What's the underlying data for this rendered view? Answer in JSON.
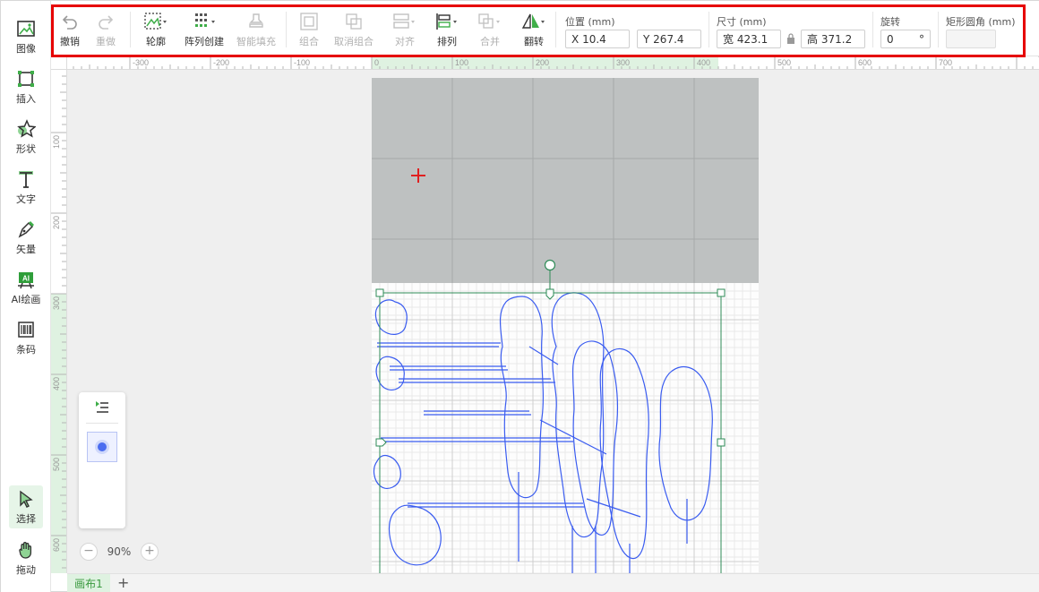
{
  "sidebar": {
    "items": [
      {
        "key": "image",
        "label": "图像",
        "icon": "image-icon"
      },
      {
        "key": "insert",
        "label": "插入",
        "icon": "insert-frame-icon"
      },
      {
        "key": "shape",
        "label": "形状",
        "icon": "star-shape-icon"
      },
      {
        "key": "text",
        "label": "文字",
        "icon": "text-icon"
      },
      {
        "key": "vector",
        "label": "矢量",
        "icon": "pen-icon"
      },
      {
        "key": "ai-draw",
        "label": "AI绘画",
        "icon": "ai-icon"
      },
      {
        "key": "barcode",
        "label": "条码",
        "icon": "barcode-icon"
      },
      {
        "key": "select",
        "label": "选择",
        "icon": "cursor-icon",
        "active": true
      },
      {
        "key": "drag",
        "label": "拖动",
        "icon": "hand-icon"
      }
    ],
    "ai_badge": "AI"
  },
  "toolbar": {
    "undo": "撤销",
    "redo": "重做",
    "outline": "轮廓",
    "array_create": "阵列创建",
    "smart_fill": "智能填充",
    "group": "组合",
    "ungroup": "取消组合",
    "align": "对齐",
    "arrange": "排列",
    "merge": "合并",
    "flip": "翻转",
    "position": {
      "title": "位置 (mm)",
      "x_label": "X",
      "x_value": "10.4",
      "y_label": "Y",
      "y_value": "267.4"
    },
    "size": {
      "title": "尺寸 (mm)",
      "w_label": "宽",
      "w_value": "423.1",
      "h_label": "高",
      "h_value": "371.2"
    },
    "rotation": {
      "title": "旋转",
      "value": "0",
      "unit": "°"
    },
    "corner": {
      "title": "矩形圆角 (mm)",
      "value": ""
    }
  },
  "ruler": {
    "top_ticks": [
      "-300",
      "-200",
      "-100",
      "0",
      "100",
      "200",
      "300",
      "400",
      "500",
      "600",
      "700"
    ],
    "left_ticks": [
      "100",
      "200",
      "300",
      "400",
      "500",
      "600"
    ]
  },
  "zoom": {
    "value": "90%",
    "minus": "−",
    "plus": "+"
  },
  "pages": {
    "tab_label": "画布1",
    "add_label": "+"
  },
  "colors": {
    "accent": "#3fae49",
    "selection": "#2e8b57",
    "vector_stroke": "#3a5cf0",
    "highlight": "#e60000",
    "crosshair": "#e02020"
  }
}
